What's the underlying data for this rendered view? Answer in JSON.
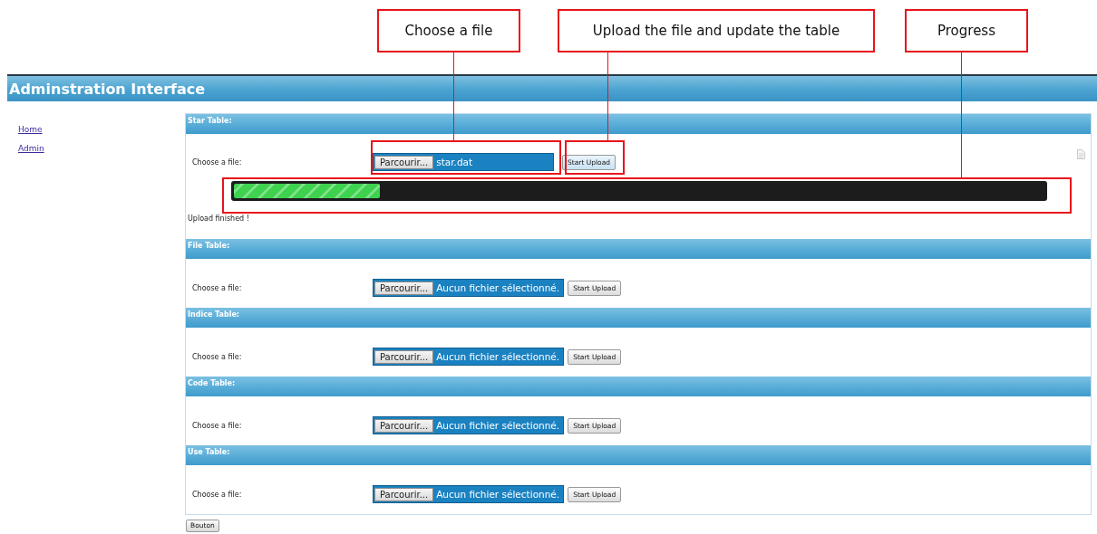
{
  "callouts": [
    {
      "text": "Choose a file"
    },
    {
      "text": "Upload the file and update the table"
    },
    {
      "text": "Progress"
    }
  ],
  "header": {
    "title": "Adminstration Interface"
  },
  "nav": [
    {
      "label": "Home"
    },
    {
      "label": "Admin"
    }
  ],
  "sections": [
    {
      "title": "Star Table:",
      "label": "Choose a file:",
      "browse": "Parcourir...",
      "file_text": "star.dat",
      "upload": "Start Upload",
      "progress": {
        "level": 0.18
      },
      "status": "Upload finished !"
    },
    {
      "title": "File Table:",
      "label": "Choose a file:",
      "browse": "Parcourir...",
      "file_text": "Aucun fichier sélectionné.",
      "upload": "Start Upload"
    },
    {
      "title": "Indice Table:",
      "label": "Choose a file:",
      "browse": "Parcourir...",
      "file_text": "Aucun fichier sélectionné.",
      "upload": "Start Upload"
    },
    {
      "title": "Code Table:",
      "label": "Choose a file:",
      "browse": "Parcourir...",
      "file_text": "Aucun fichier sélectionné.",
      "upload": "Start Upload"
    },
    {
      "title": "Use Table:",
      "label": "Choose a file:",
      "browse": "Parcourir...",
      "file_text": "Aucun fichier sélectionné.",
      "upload": "Start Upload"
    }
  ],
  "bottom_button": "Bouton"
}
